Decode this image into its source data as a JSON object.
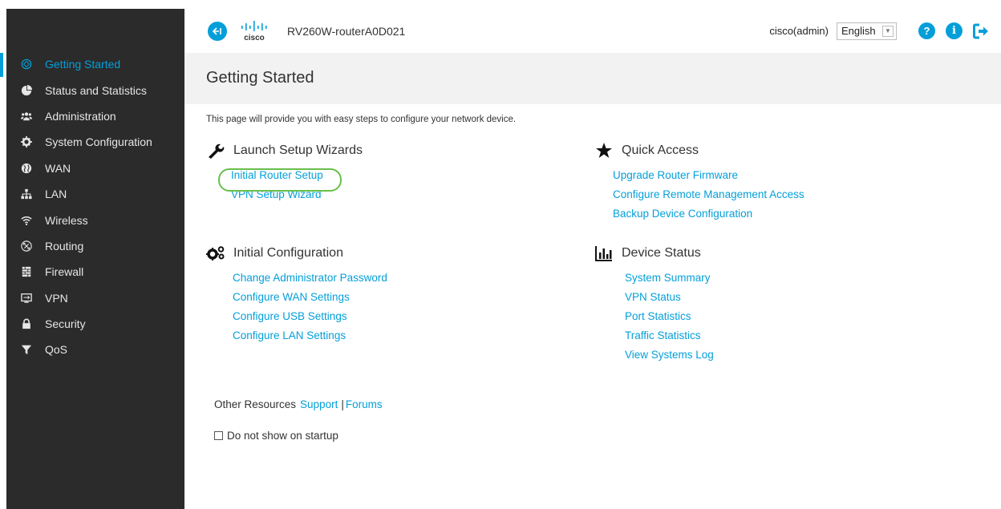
{
  "header": {
    "logo_text": "cisco",
    "device_name": "RV260W-routerA0D021",
    "user": "cisco(admin)",
    "language": "English"
  },
  "sidebar": {
    "items": [
      {
        "label": "Getting Started",
        "icon": "getting-started-icon",
        "active": true
      },
      {
        "label": "Status and Statistics",
        "icon": "pie-chart-icon"
      },
      {
        "label": "Administration",
        "icon": "users-icon"
      },
      {
        "label": "System Configuration",
        "icon": "gear-icon"
      },
      {
        "label": "WAN",
        "icon": "globe-icon"
      },
      {
        "label": "LAN",
        "icon": "sitemap-icon"
      },
      {
        "label": "Wireless",
        "icon": "wifi-icon"
      },
      {
        "label": "Routing",
        "icon": "routing-icon"
      },
      {
        "label": "Firewall",
        "icon": "firewall-icon"
      },
      {
        "label": "VPN",
        "icon": "vpn-icon"
      },
      {
        "label": "Security",
        "icon": "lock-icon"
      },
      {
        "label": "QoS",
        "icon": "filter-icon"
      }
    ]
  },
  "page": {
    "title": "Getting Started",
    "intro": "This page will provide you with easy steps to configure your network device."
  },
  "sections": {
    "launch": {
      "title": "Launch Setup Wizards",
      "links": [
        "Initial Router Setup",
        "VPN Setup Wizard"
      ]
    },
    "initial": {
      "title": "Initial Configuration",
      "links": [
        "Change Administrator Password",
        "Configure WAN Settings",
        "Configure USB Settings",
        "Configure LAN Settings"
      ]
    },
    "quick": {
      "title": "Quick Access",
      "links": [
        "Upgrade Router Firmware",
        "Configure Remote Management Access",
        "Backup Device Configuration"
      ]
    },
    "status": {
      "title": "Device Status",
      "links": [
        "System Summary",
        "VPN Status",
        "Port Statistics",
        "Traffic Statistics",
        "View Systems Log"
      ]
    }
  },
  "footer": {
    "other_resources": "Other Resources",
    "support": "Support",
    "separator": "|",
    "forums": "Forums",
    "startup_label": "Do not show on startup"
  },
  "colors": {
    "accent": "#049fd9",
    "sidebar_bg": "#2b2b2b",
    "highlight": "#6abf4b"
  }
}
